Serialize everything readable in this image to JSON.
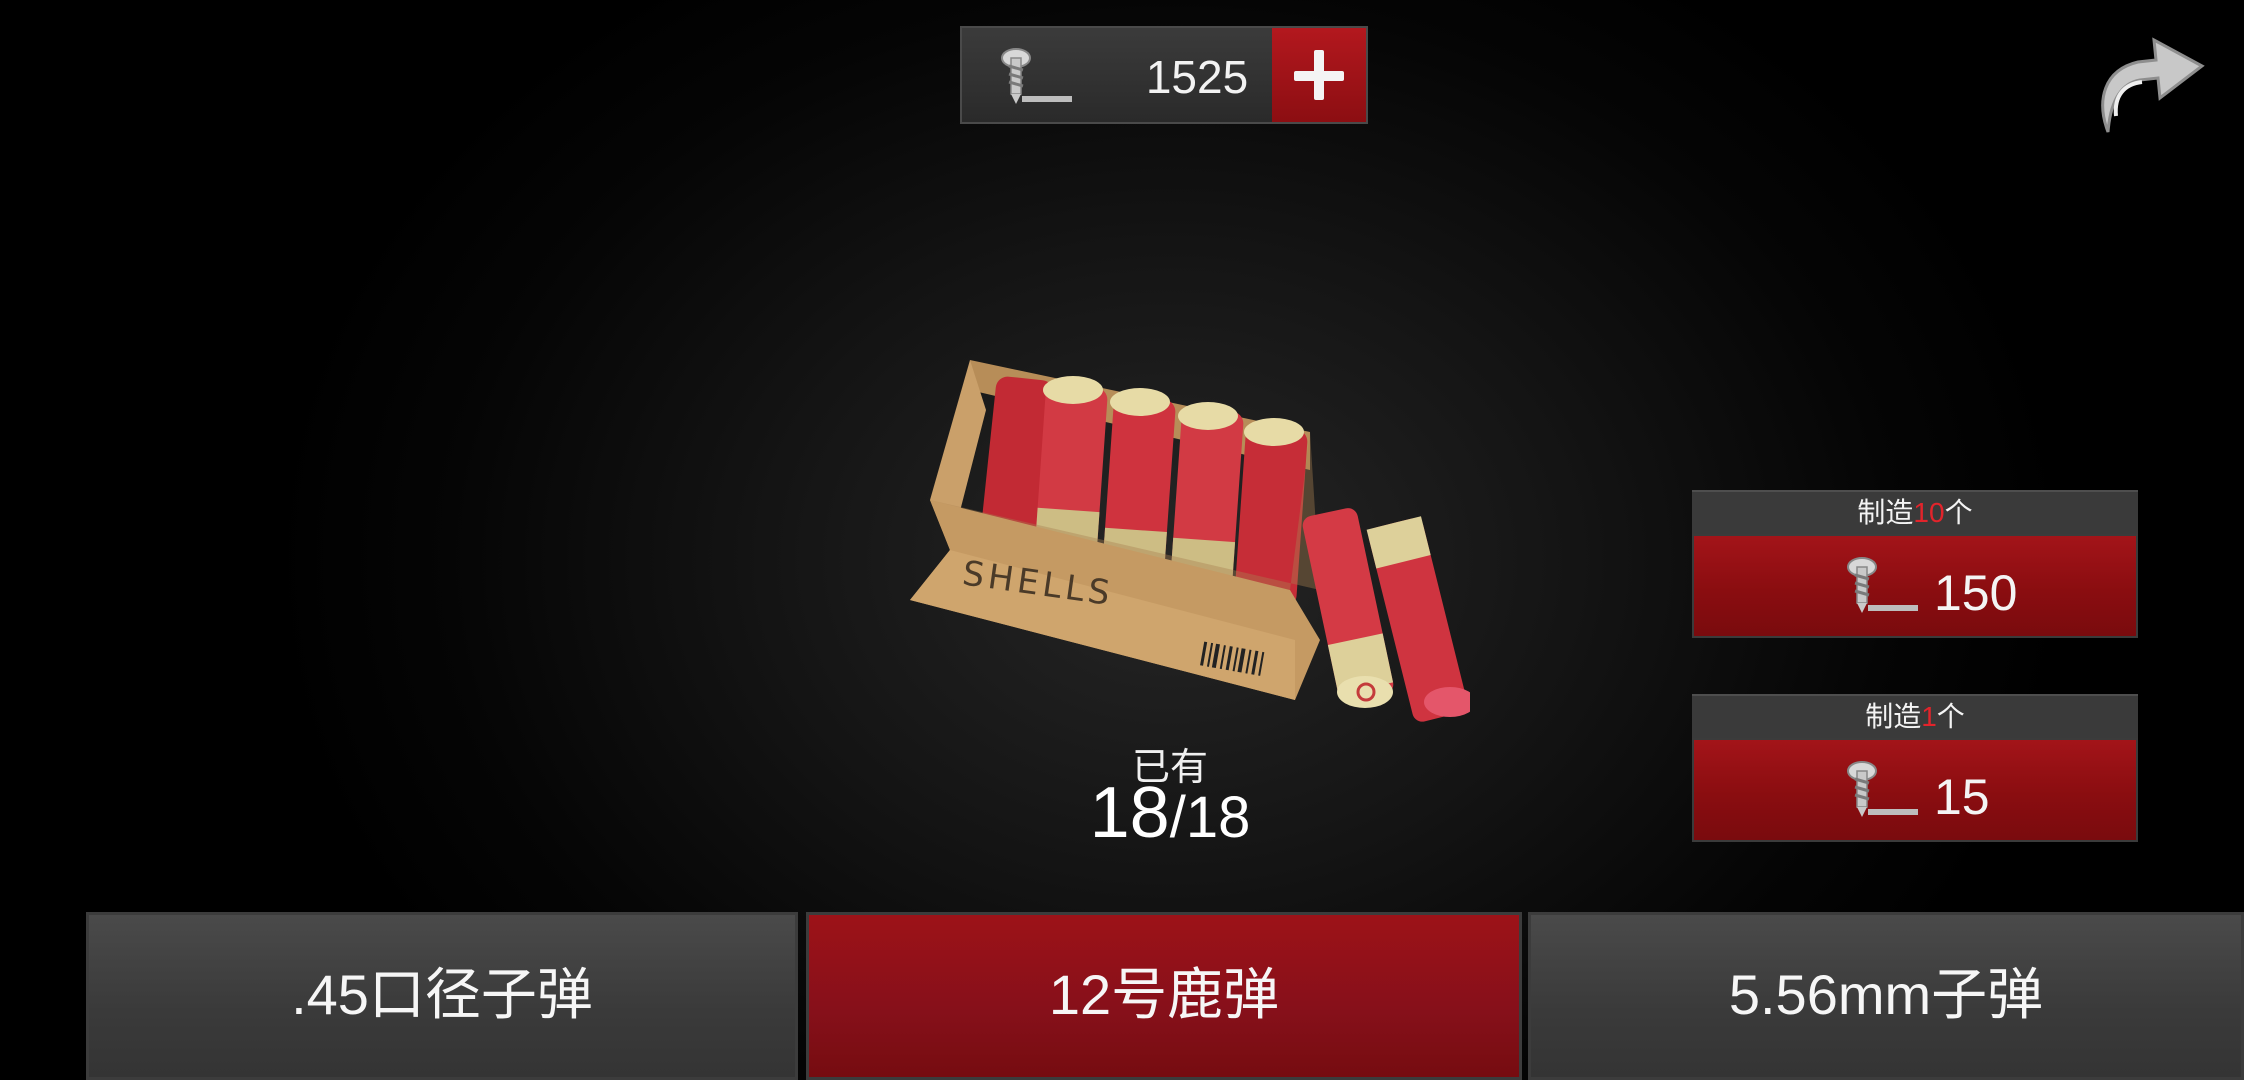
{
  "currency": {
    "value": "1525",
    "icon": "screw-icon"
  },
  "back": {
    "icon": "back-arrow-icon"
  },
  "item": {
    "box_text": "SHELLS"
  },
  "owned": {
    "label": "已有",
    "current": "18",
    "separator": "/",
    "max": "18"
  },
  "craft_options": [
    {
      "prefix": "制造",
      "qty": "10",
      "suffix": "个",
      "price": "150"
    },
    {
      "prefix": "制造",
      "qty": "1",
      "suffix": "个",
      "price": "15"
    }
  ],
  "ammo_tabs": [
    {
      "label": ".45口径子弹",
      "active": false
    },
    {
      "label": "12号鹿弹",
      "active": true
    },
    {
      "label": "5.56mm子弹",
      "active": false
    }
  ],
  "colors": {
    "accent_red": "#a31419",
    "panel_gray": "#3a3a3a",
    "qty_red": "#e2242b"
  }
}
